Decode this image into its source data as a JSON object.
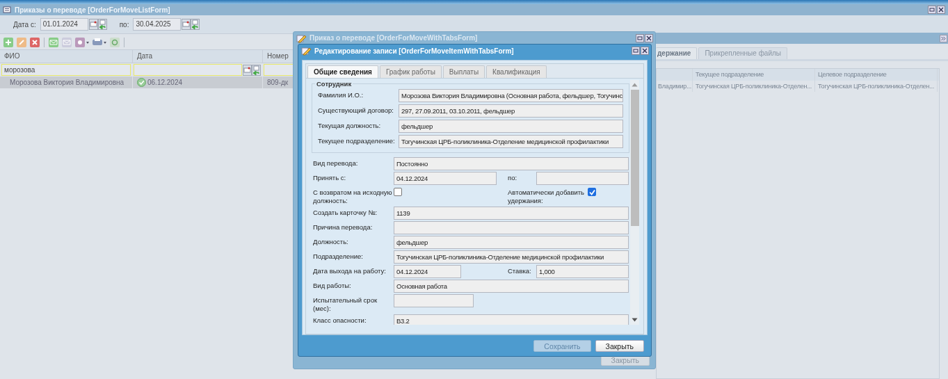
{
  "list_window": {
    "title": "Приказы о переводе [OrderForMoveListForm]",
    "filters": [
      {
        "label": "Дата с:",
        "value": "01.01.2024"
      },
      {
        "label": "по:",
        "value": "30.04.2025"
      }
    ],
    "grid": {
      "columns": [
        "ФИО",
        "Дата",
        "Номер"
      ],
      "name_filter": "морозова",
      "rows": [
        {
          "fio": "Морозова Виктория Владимировна",
          "date": "06.12.2024",
          "number": "809-дк",
          "signed": true,
          "selected": true
        }
      ]
    }
  },
  "detail_panel": {
    "tabs": [
      {
        "label": "держание",
        "selected": true
      },
      {
        "label": "Прикрепленные файлы",
        "selected": false
      }
    ],
    "columns": [
      "",
      "Текущее подразделение",
      "Целевое подразделение"
    ],
    "rows": [
      [
        "Владимир...",
        "Тогучинская ЦРБ-поликлиника-Отделен...",
        "Тогучинская ЦРБ-поликлиника-Отделен..."
      ]
    ]
  },
  "order_window": {
    "title": "Приказ о переводе [OrderForMoveWithTabsForm]",
    "buttons": [
      {
        "label": "Закрыть",
        "disabled": true
      }
    ]
  },
  "edit_window": {
    "title": "Редактирование записи [OrderForMoveItemWithTabsForm]",
    "tabs": [
      {
        "label": "Общие сведения",
        "selected": true
      },
      {
        "label": "График работы",
        "selected": false
      },
      {
        "label": "Выплаты",
        "selected": false
      },
      {
        "label": "Квалификация",
        "selected": false
      }
    ],
    "employee": {
      "legend": "Сотрудник",
      "fields": [
        {
          "label": "Фамилия И.О.:",
          "value": "Морозова Виктория Владимировна (Основная работа, фельдшер, Тогучинс"
        },
        {
          "label": "Существующий договор:",
          "value": "297, 27.09.2011, 03.10.2011, фельдшер"
        },
        {
          "label": "Текущая должность:",
          "value": "фельдшер"
        },
        {
          "label": "Текущее подразделение:",
          "value": "Тогучинская ЦРБ-поликлиника-Отделение медицинской профилактики"
        }
      ]
    },
    "rows": [
      [
        {
          "kind": "text",
          "label": "Вид перевода:",
          "value": "Постоянно"
        }
      ],
      [
        {
          "kind": "text",
          "label": "Принять с:",
          "value": "04.12.2024"
        },
        {
          "kind": "text",
          "label": "по:"
        }
      ],
      [
        {
          "kind": "checkbox",
          "label": "С возвратом на исходную должность:",
          "checked": false
        },
        {
          "kind": "checkbox",
          "label": "Автоматически добавить удержания:",
          "checked": true
        }
      ],
      [
        {
          "kind": "text",
          "label": "Создать карточку №:",
          "value": "1139"
        }
      ],
      [
        {
          "kind": "text",
          "label": "Причина перевода:"
        }
      ],
      [
        {
          "kind": "text",
          "label": "Должность:",
          "value": "фельдшер"
        }
      ],
      [
        {
          "kind": "text",
          "label": "Подразделение:",
          "value": "Тогучинская ЦРБ-поликлиника-Отделение медицинской профилактики"
        }
      ],
      [
        {
          "kind": "short",
          "label": "Дата выхода на работу:",
          "value": "04.12.2024"
        },
        {
          "kind": "text",
          "label": "Ставка:",
          "value": "1,000"
        }
      ],
      [
        {
          "kind": "text",
          "label": "Вид работы:",
          "value": "Основная работа"
        }
      ],
      [
        {
          "kind": "short",
          "label": "Испытательный срок (мес):"
        }
      ],
      [
        {
          "kind": "text",
          "label": "Класс опасности:",
          "value": "В3.2"
        }
      ]
    ],
    "buttons": [
      {
        "label": "Сохранить",
        "disabled": true
      },
      {
        "label": "Закрыть",
        "disabled": false
      }
    ]
  }
}
